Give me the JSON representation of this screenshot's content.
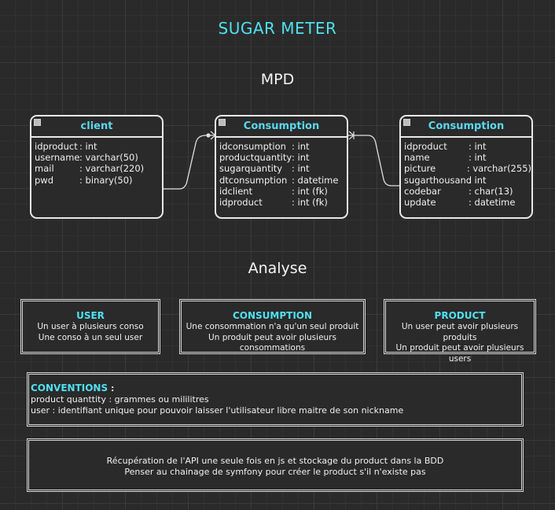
{
  "title": "SUGAR METER",
  "mpd_heading": "MPD",
  "analyse_heading": "Analyse",
  "entities": [
    {
      "name": "client",
      "attributes": [
        {
          "name": "idproduct",
          "type": ": int"
        },
        {
          "name": "username",
          "type": ": varchar(50)"
        },
        {
          "name": "mail",
          "type": ": varchar(220)"
        },
        {
          "name": "pwd",
          "type": ": binary(50)"
        }
      ]
    },
    {
      "name": "Consumption",
      "attributes": [
        {
          "name": "idconsumption",
          "type": ": int"
        },
        {
          "name": "productquantity",
          "type": ": int"
        },
        {
          "name": "sugarquantity",
          "type": ": int"
        },
        {
          "name": "dtconsumption",
          "type": ": datetime"
        },
        {
          "name": "idclient",
          "type": ": int (fk)"
        },
        {
          "name": "idproduct",
          "type": ": int (fk)"
        }
      ]
    },
    {
      "name": "Consumption",
      "attributes": [
        {
          "name": "idproduct",
          "type": ": int"
        },
        {
          "name": "name",
          "type": ": int"
        },
        {
          "name": "picture",
          "type": ": varchar(255)"
        },
        {
          "name": "sugarthousand",
          "type": ": int"
        },
        {
          "name": "codebar",
          "type": ": char(13)"
        },
        {
          "name": "update",
          "type": ": datetime"
        }
      ]
    }
  ],
  "analyse": [
    {
      "title": "USER",
      "lines": [
        "Un user à plusieurs conso",
        "Une conso à un seul user"
      ]
    },
    {
      "title": "CONSUMPTION",
      "lines": [
        "Une consommation n'a qu'un seul produit",
        "Un produit peut avoir plusieurs consommations"
      ]
    },
    {
      "title": "PRODUCT",
      "lines": [
        "Un user peut avoir plusieurs produits",
        "Un produit peut avoir plusieurs users"
      ]
    }
  ],
  "conventions": {
    "title": "CONVENTIONS",
    "suffix": " :",
    "lines": [
      "product quanttity : grammes ou mililitres",
      "user : identifiant unique pour pouvoir laisser l'utilisateur libre maitre de son nickname"
    ]
  },
  "notes": [
    "Récupération de l'API une seule fois en js et stockage du product dans la BDD",
    "Penser au chainage de symfony pour créer le product s'il n'existe pas"
  ],
  "colors": {
    "accent": "#4fe0f0",
    "header_text": "#5ad8f0",
    "border": "#e8e8e8",
    "background": "#2a2a2a"
  }
}
